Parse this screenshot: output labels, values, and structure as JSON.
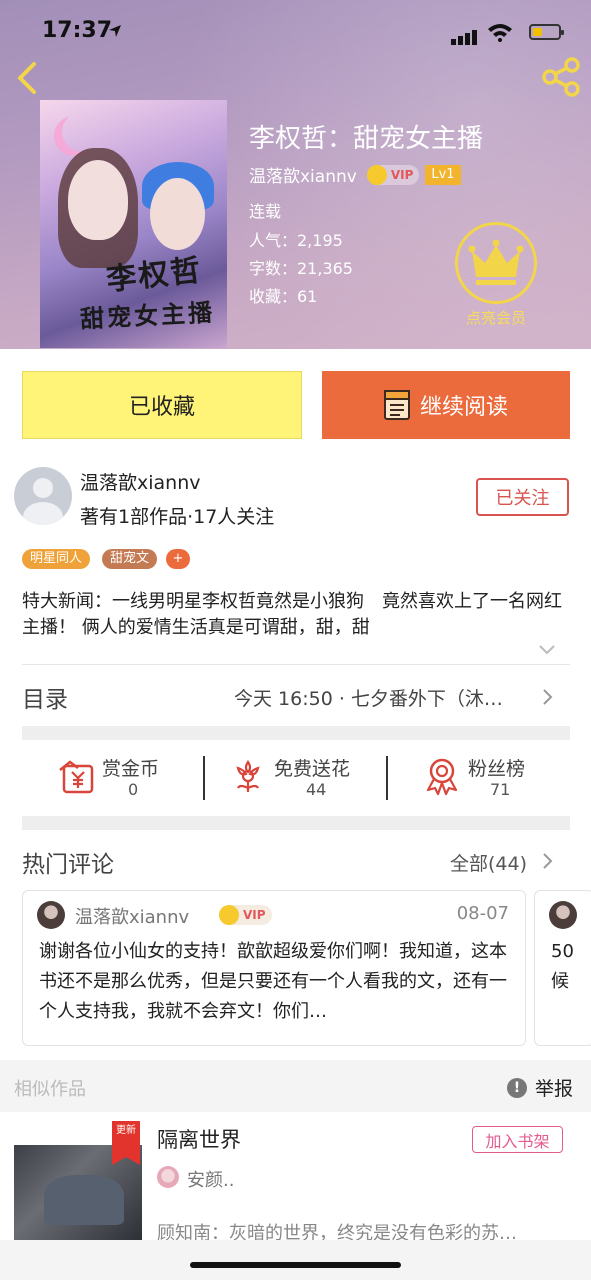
{
  "status_bar": {
    "time": "17:37"
  },
  "book": {
    "title": "李权哲：甜宠女主播",
    "author": "温落歆xiannv",
    "vip_badge": "VIP",
    "level": "Lv1",
    "status": "连载",
    "popularity": "人气：2,195",
    "word_count": "字数：21,365",
    "favorites": "收藏：61",
    "cover_text_line1": "李权哲",
    "cover_text_line2": "甜宠女主播"
  },
  "membership": {
    "label": "点亮会员"
  },
  "actions": {
    "favorited_label": "已收藏",
    "continue_label": "继续阅读"
  },
  "author_card": {
    "name": "温落歆xiannv",
    "stats": "著有1部作品·17人关注",
    "follow_label": "已关注"
  },
  "tags": [
    {
      "label": "明星同人",
      "color": "#f0a23a"
    },
    {
      "label": "甜宠文",
      "color": "#c47a52"
    },
    {
      "label": "+",
      "color": "#ec6b3c"
    }
  ],
  "description": "特大新闻：一线男明星李权哲竟然是小狼狗　竟然喜欢上了一名网红主播！ 俩人的爱情生活真是可谓甜，甜，甜",
  "toc": {
    "title": "目录",
    "latest": "今天 16:50 · 七夕番外下（沐…"
  },
  "stats": [
    {
      "icon": "coin-reward-icon",
      "label": "赏金币",
      "value": "0"
    },
    {
      "icon": "flower-icon",
      "label": "免费送花",
      "value": "44"
    },
    {
      "icon": "rank-ribbon-icon",
      "label": "粉丝榜",
      "value": "71"
    }
  ],
  "comments_section": {
    "title": "热门评论",
    "all_label": "全部(44)",
    "items": [
      {
        "user": "温落歆xiannv",
        "vip": "VIP",
        "date": "08-07",
        "text": "谢谢各位小仙女的支持！歆歆超级爱你们啊！我知道，这本书还不是那么优秀，但是只要还有一个人看我的文，还有一个人支持我，我就不会弃文！你们…"
      },
      {
        "text_line1": "50",
        "text_line2": "候"
      }
    ]
  },
  "similar": {
    "title": "相似作品",
    "report_label": "举报",
    "item": {
      "badge": "更新",
      "title": "隔离世界",
      "shelf_label": "加入书架",
      "author": "安颜..",
      "desc": "顾知南：灰暗的世界，终究是没有色彩的苏…"
    }
  },
  "colors": {
    "accent": "#ec6b3c",
    "favorite_bg": "#fff478",
    "follow": "#d9534f",
    "gold": "#f3d54a"
  }
}
